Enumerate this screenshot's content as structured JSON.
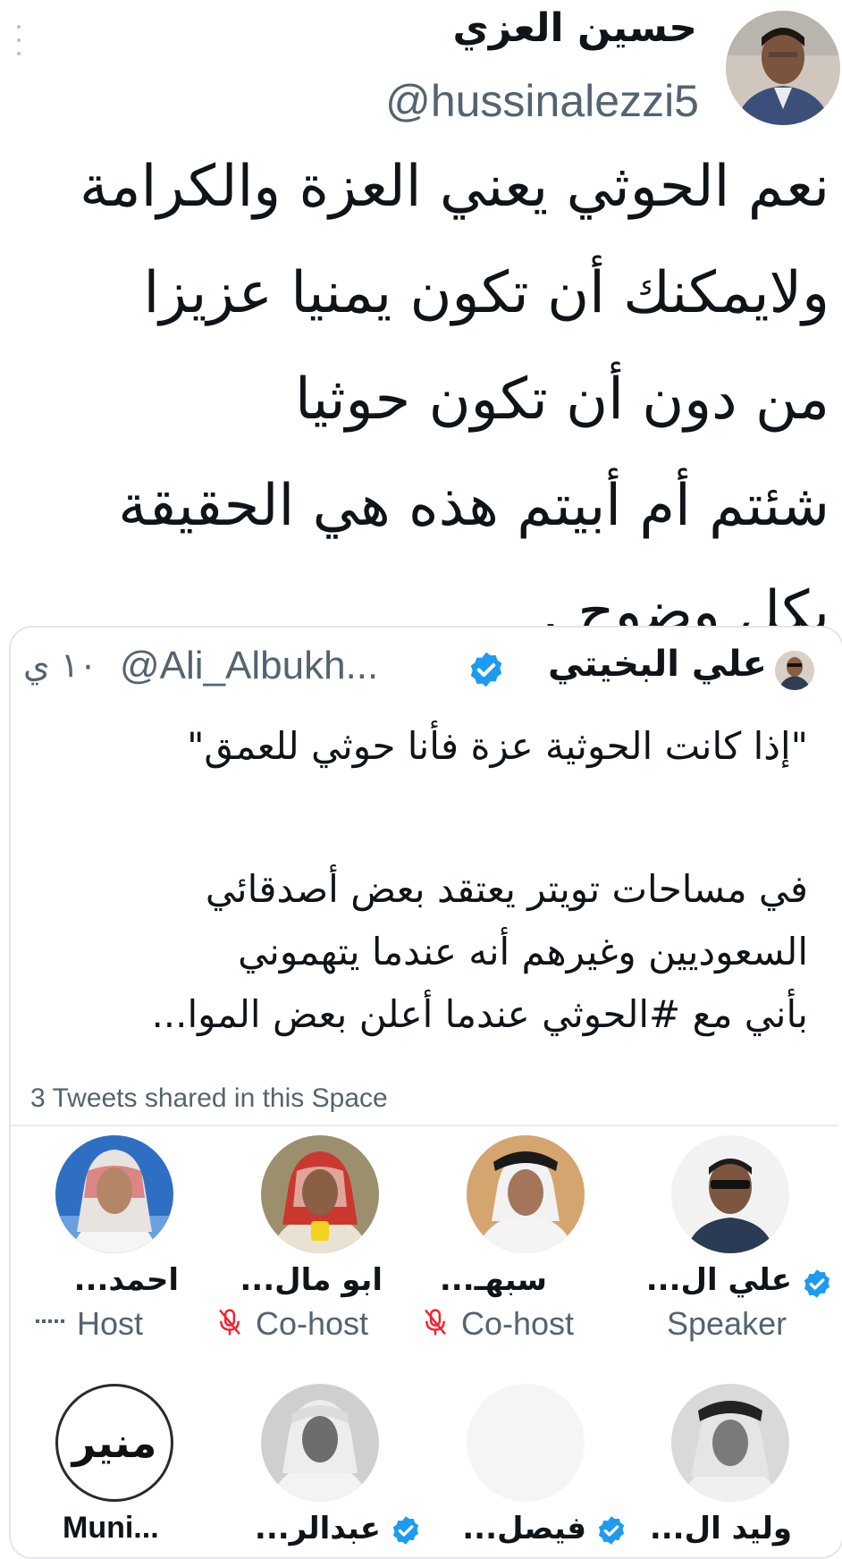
{
  "author": {
    "display_name": "حسين العزي",
    "handle": "@hussinalezzi5"
  },
  "tweet": {
    "text": "نعم الحوثي يعني العزة والكرامة\nولايمكنك أن تكون يمنيا عزيزا\nمن دون أن تكون حوثيا\nشئتم أم أبيتم هذه هي الحقيقة\nبكل وضوح ."
  },
  "quoted": {
    "display_name": "علي البخيتي",
    "handle": "@Ali_Albukh...",
    "time": "١٠ ي",
    "quote_line": "\"إذا كانت الحوثية عزة فأنا حوثي للعمق\"",
    "body": "في مساحات تويتر يعتقد بعض أصدقائي\nالسعوديين وغيرهم أنه عندما يتهموني\nبأني مع #الحوثي عندما أعلن بعض الموا..."
  },
  "space": {
    "label": "3 Tweets shared in this Space",
    "participants_row1": [
      {
        "name": "علي ال...",
        "role": "Speaker"
      },
      {
        "name": "سبهـ...",
        "role": "Co-host"
      },
      {
        "name": "ابو مال...",
        "role": "Co-host"
      },
      {
        "name": "احمد...",
        "role": "Host"
      }
    ],
    "participants_row2": [
      {
        "name": "وليد ال..."
      },
      {
        "name": "فيصل..."
      },
      {
        "name": "عبدالر..."
      },
      {
        "name": "Muni..."
      }
    ],
    "logo_text": "منير"
  },
  "colors": {
    "verified": "#1d9bf0",
    "secondary_text": "#536471",
    "mic_off": "#f4212e"
  }
}
